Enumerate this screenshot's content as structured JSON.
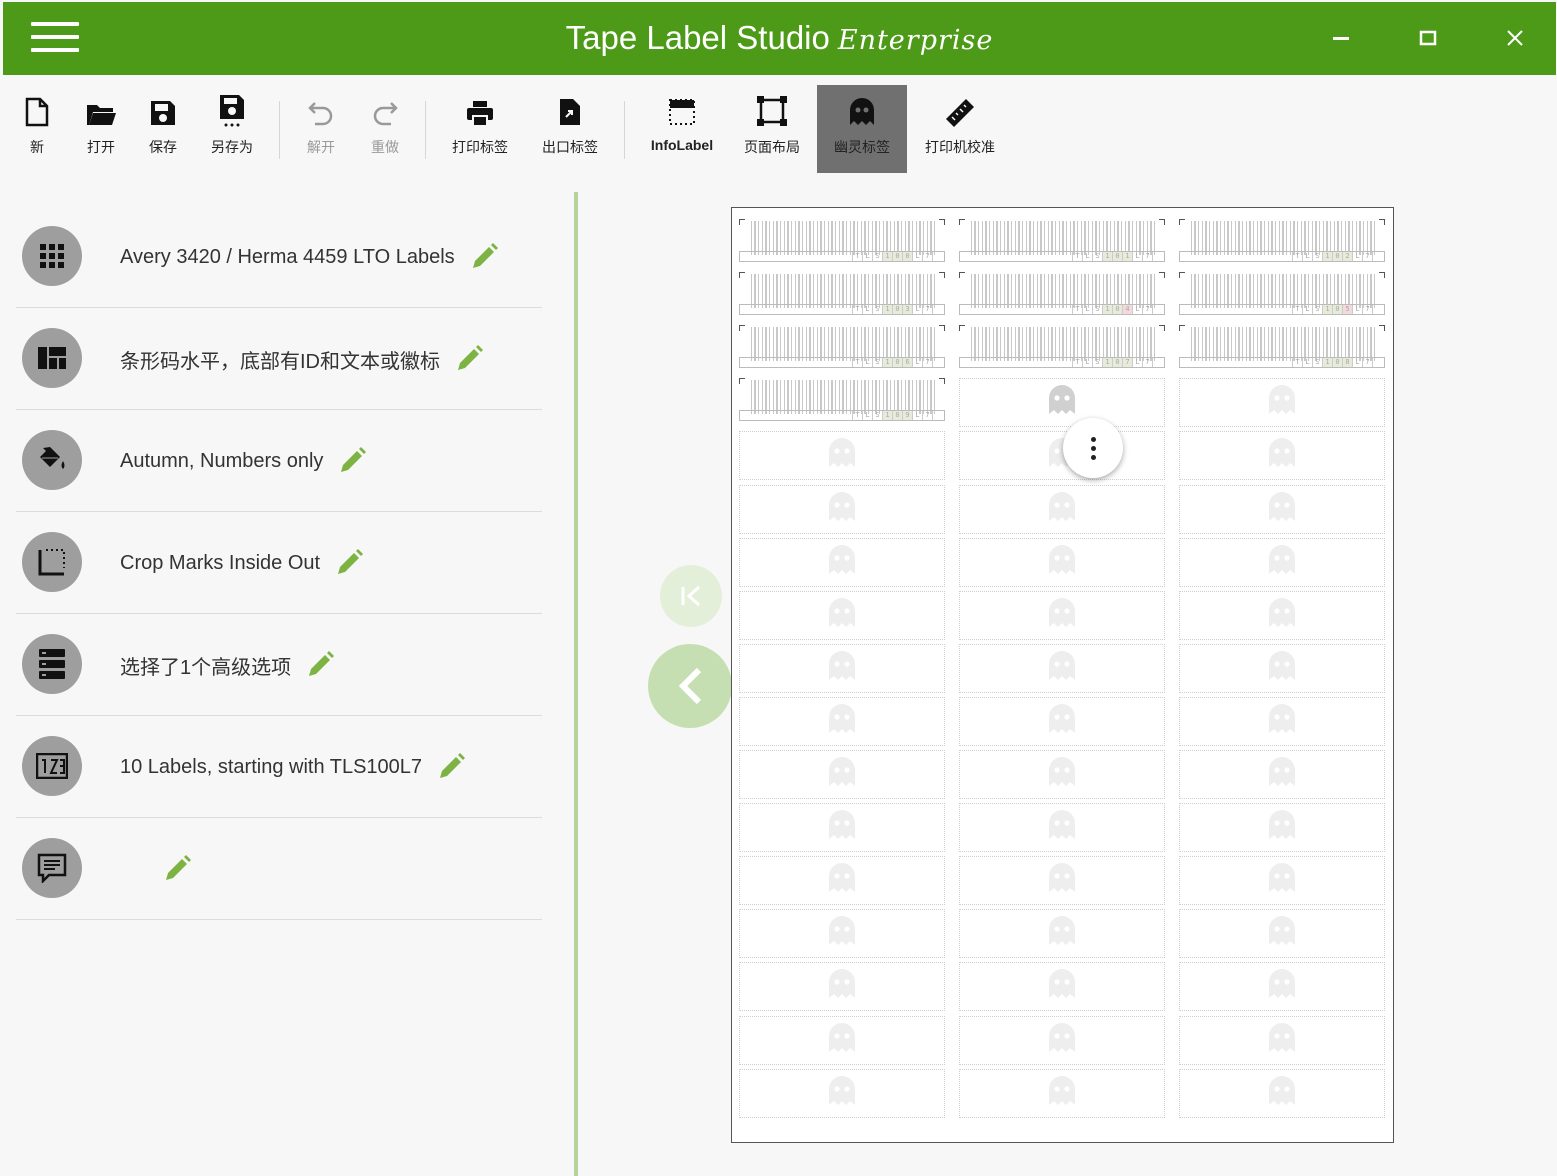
{
  "window": {
    "title": "Tape Label Studio",
    "edition": "Enterprise"
  },
  "toolbar": {
    "new": "新",
    "open": "打开",
    "save": "保存",
    "save_as": "另存为",
    "undo": "解开",
    "redo": "重做",
    "print_labels": "打印标签",
    "export_labels": "出口标签",
    "info_label": "InfoLabel",
    "page_layout": "页面布局",
    "ghost_labels": "幽灵标签",
    "printer_calibration": "打印机校准"
  },
  "settings": [
    {
      "icon": "grid-icon",
      "label": "Avery 3420 / Herma 4459 LTO Labels"
    },
    {
      "icon": "layout-icon",
      "label": "条形码水平，底部有ID和文本或徽标"
    },
    {
      "icon": "paint-bucket-icon",
      "label": "Autumn, Numbers only"
    },
    {
      "icon": "crop-marks-icon",
      "label": "Crop Marks Inside Out"
    },
    {
      "icon": "storage-icon",
      "label": "选择了1个高级选项"
    },
    {
      "icon": "counter-icon",
      "label": "10 Labels, starting with TLS100L7"
    },
    {
      "icon": "comment-icon",
      "label": ""
    }
  ],
  "sheet": {
    "columns": 3,
    "rows": 17,
    "filled_labels": [
      {
        "id": "TLS100L7"
      },
      {
        "id": "TLS101L7"
      },
      {
        "id": "TLS102L7"
      },
      {
        "id": "TLS103L7"
      },
      {
        "id": "TLS104L7"
      },
      {
        "id": "TLS105L7"
      },
      {
        "id": "TLS106L7"
      },
      {
        "id": "TLS107L7"
      },
      {
        "id": "TLS108L7"
      },
      {
        "id": "TLS109L7"
      }
    ]
  },
  "colors": {
    "brand": "#4c9a18",
    "accent_pencil": "#7cb342",
    "icon_circle": "#9e9e9e"
  }
}
